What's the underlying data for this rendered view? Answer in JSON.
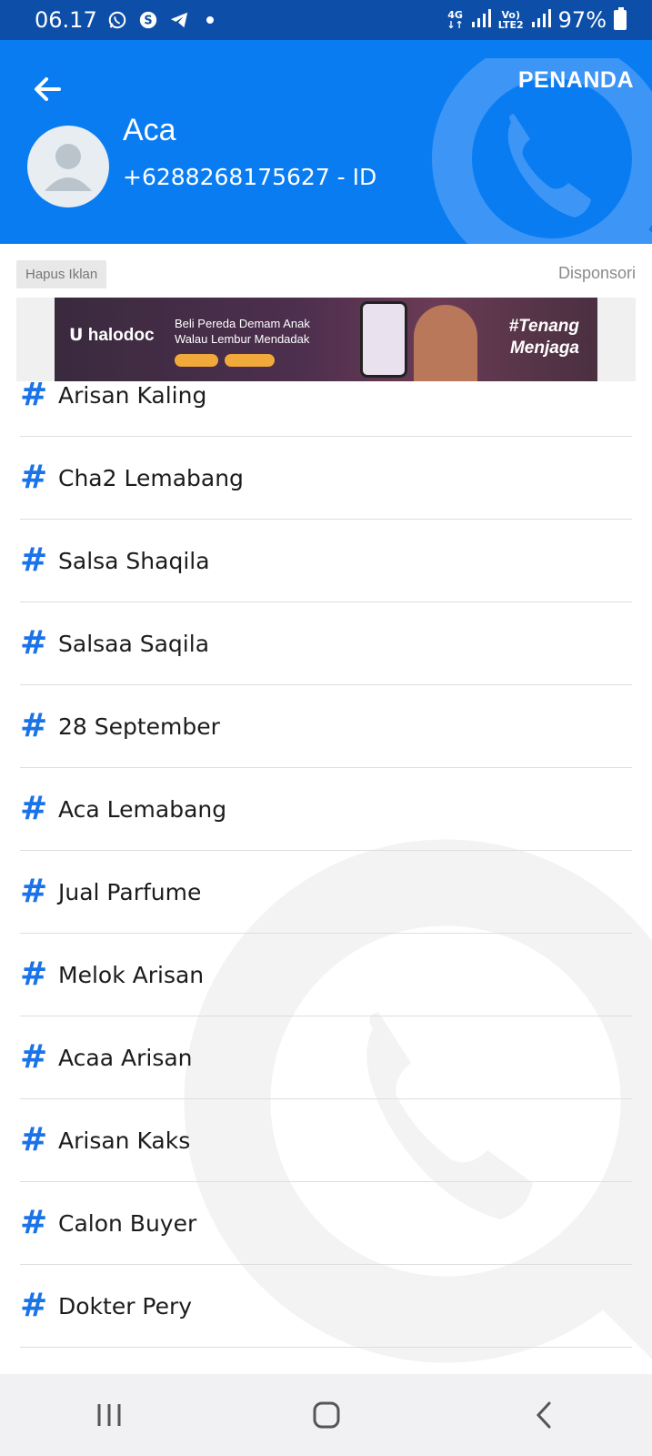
{
  "status_bar": {
    "time": "06.17",
    "network_top": "4G",
    "network_lte_top": "Vo)",
    "network_lte_bottom": "LTE2",
    "battery": "97%"
  },
  "header": {
    "back_icon": "arrow-left-icon",
    "tag_button": "PENANDA",
    "contact_name": "Aca",
    "contact_phone": "+6288268175627 - ID",
    "accent_color": "#0a7cf2"
  },
  "ad": {
    "remove_label": "Hapus Iklan",
    "sponsored_label": "Disponsori",
    "brand": "halodoc",
    "headline_1": "Beli Pereda Demam Anak",
    "headline_2": "Walau Lembur Mendadak",
    "slogan_1": "#Tenang",
    "slogan_2": "Menjaga"
  },
  "tags": [
    {
      "label": "Arisan Kaling"
    },
    {
      "label": "Cha2 Lemabang"
    },
    {
      "label": "Salsa Shaqila"
    },
    {
      "label": "Salsaa Saqila"
    },
    {
      "label": "28 September"
    },
    {
      "label": "Aca Lemabang"
    },
    {
      "label": "Jual Parfume"
    },
    {
      "label": "Melok Arisan"
    },
    {
      "label": "Acaa Arisan"
    },
    {
      "label": "Arisan Kaks"
    },
    {
      "label": "Calon Buyer"
    },
    {
      "label": "Dokter Pery"
    }
  ],
  "tag_symbol": "#",
  "nav": {
    "recents_icon": "recents-icon",
    "home_icon": "home-icon",
    "back_icon": "back-chevron-icon"
  }
}
